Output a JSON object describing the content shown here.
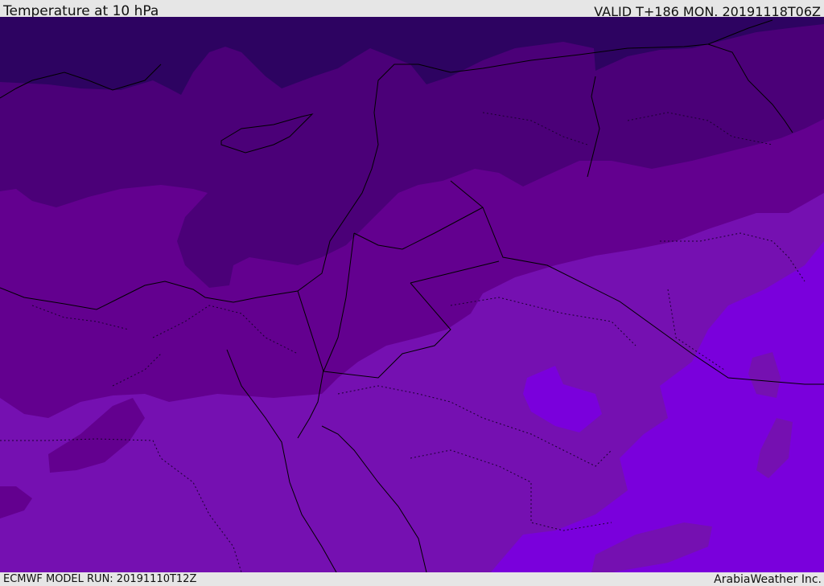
{
  "header": {
    "title": "Temperature at 10 hPa",
    "valid": "VALID T+186 MON. 20191118T06Z"
  },
  "footer": {
    "model_run": "ECMWF MODEL RUN: 20191110T12Z",
    "credit": "ArabiaWeather Inc."
  },
  "map": {
    "field": "temperature",
    "level_hpa": 10,
    "colors": {
      "band_coldest": "#2d0361",
      "band_2": "#4b0078",
      "band_3": "#63008f",
      "band_4": "#7510b1",
      "band_warmest": "#7a00dc",
      "coastline": "#000000",
      "border_dotted": "#1a0030"
    }
  }
}
